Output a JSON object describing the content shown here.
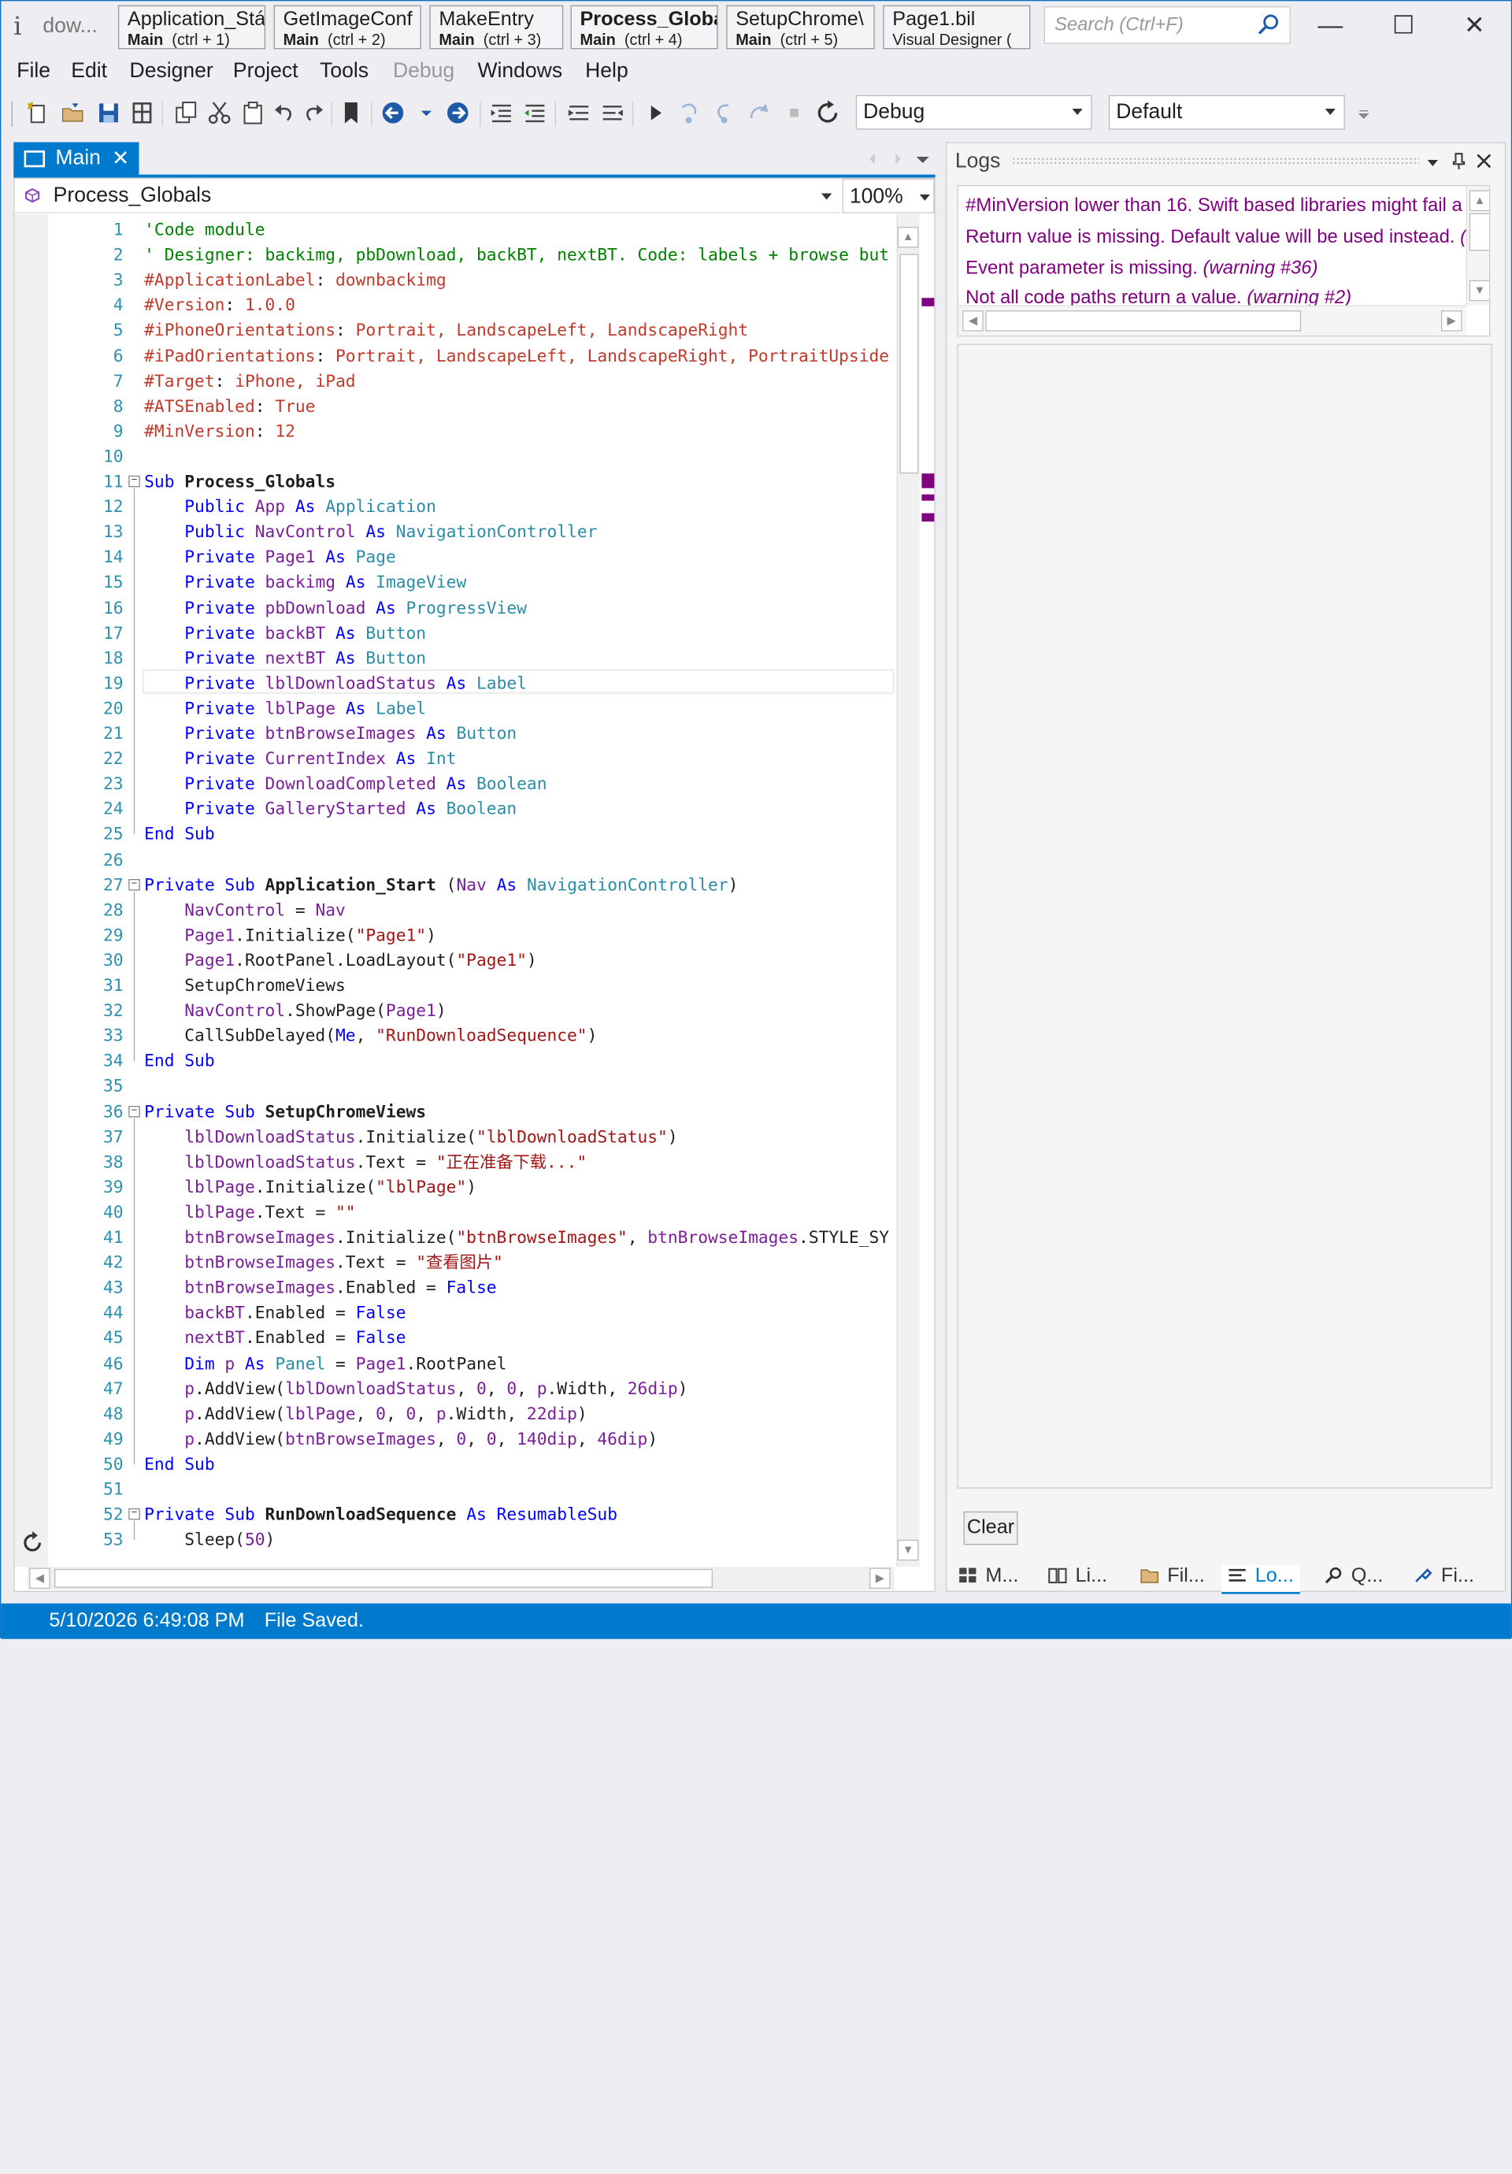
{
  "window": {
    "app_title": "dow...",
    "search_placeholder": "Search (Ctrl+F)",
    "minimize": "—",
    "maximize": "☐",
    "close": "✕"
  },
  "module_tabs": [
    {
      "name": "Application_Stá",
      "sub_bold": "Main",
      "sub": "(ctrl + 1)"
    },
    {
      "name": "GetImageConf",
      "sub_bold": "Main",
      "sub": "(ctrl + 2)"
    },
    {
      "name": "MakeEntry",
      "sub_bold": "Main",
      "sub": "(ctrl + 3)"
    },
    {
      "name": "Process_Globa",
      "sub_bold": "Main",
      "sub": "(ctrl + 4)"
    },
    {
      "name": "SetupChrome\\",
      "sub_bold": "Main",
      "sub": "(ctrl + 5)"
    },
    {
      "name": "Page1.bil",
      "sub_bold": "",
      "sub": "Visual Designer  ("
    }
  ],
  "menu": [
    "File",
    "Edit",
    "Designer",
    "Project",
    "Tools",
    "Debug",
    "Windows",
    "Help"
  ],
  "toolbar": {
    "config": "Debug",
    "platform": "Default"
  },
  "document_tab": {
    "label": "Main",
    "close": "✕"
  },
  "editor": {
    "sub_selector": "Process_Globals",
    "zoom": "100%"
  },
  "code_lines": [
    "'Code module",
    "' Designer: backimg, pbDownload, backBT, nextBT. Code: labels + browse but",
    "#ApplicationLabel: downbackimg",
    "#Version: 1.0.0",
    "#iPhoneOrientations: Portrait, LandscapeLeft, LandscapeRight",
    "#iPadOrientations: Portrait, LandscapeLeft, LandscapeRight, PortraitUpside",
    "#Target: iPhone, iPad",
    "#ATSEnabled: True",
    "#MinVersion: 12",
    "",
    "Sub Process_Globals",
    "    Public App As Application",
    "    Public NavControl As NavigationController",
    "    Private Page1 As Page",
    "    Private backimg As ImageView",
    "    Private pbDownload As ProgressView",
    "    Private backBT As Button",
    "    Private nextBT As Button",
    "    Private lblDownloadStatus As Label",
    "    Private lblPage As Label",
    "    Private btnBrowseImages As Button",
    "    Private CurrentIndex As Int",
    "    Private DownloadCompleted As Boolean",
    "    Private GalleryStarted As Boolean",
    "End Sub",
    "",
    "Private Sub Application_Start (Nav As NavigationController)",
    "    NavControl = Nav",
    "    Page1.Initialize(\"Page1\")",
    "    Page1.RootPanel.LoadLayout(\"Page1\")",
    "    SetupChromeViews",
    "    NavControl.ShowPage(Page1)",
    "    CallSubDelayed(Me, \"RunDownloadSequence\")",
    "End Sub",
    "",
    "Private Sub SetupChromeViews",
    "    lblDownloadStatus.Initialize(\"lblDownloadStatus\")",
    "    lblDownloadStatus.Text = \"正在准备下载...\"",
    "    lblPage.Initialize(\"lblPage\")",
    "    lblPage.Text = \"\"",
    "    btnBrowseImages.Initialize(\"btnBrowseImages\", btnBrowseImages.STYLE_SY",
    "    btnBrowseImages.Text = \"查看图片\"",
    "    btnBrowseImages.Enabled = False",
    "    backBT.Enabled = False",
    "    nextBT.Enabled = False",
    "    Dim p As Panel = Page1.RootPanel",
    "    p.AddView(lblDownloadStatus, 0, 0, p.Width, 26dip)",
    "    p.AddView(lblPage, 0, 0, p.Width, 22dip)",
    "    p.AddView(btnBrowseImages, 0, 0, 140dip, 46dip)",
    "End Sub",
    "",
    "Private Sub RunDownloadSequence As ResumableSub",
    "    Sleep(50)"
  ],
  "logs": {
    "title": "Logs",
    "messages": [
      {
        "text": "#MinVersion lower than 16. Swift based libraries might fail a",
        "warn": ""
      },
      {
        "text": "Return value is missing. Default value will be used instead. ",
        "warn": "("
      },
      {
        "text": "Event parameter is missing. ",
        "warn": "(warning #36)"
      },
      {
        "text": "Not all code paths return a value. ",
        "warn": "(warning #2)"
      }
    ],
    "clear_label": "Clear"
  },
  "bottom_tabs": [
    "M...",
    "Li...",
    "Fil...",
    "Lo...",
    "Q...",
    "Fi..."
  ],
  "status": {
    "timestamp": "5/10/2026 6:49:08 PM",
    "message": "File Saved."
  },
  "colors": {
    "accent": "#007acc",
    "warning": "#800080"
  }
}
